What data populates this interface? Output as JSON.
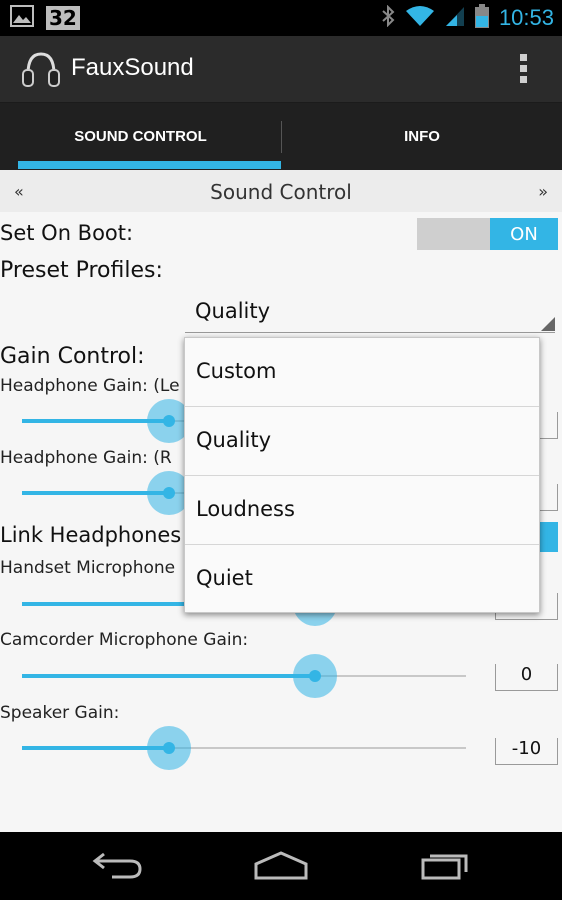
{
  "status_bar": {
    "notification_badge": "32",
    "time": "10:53",
    "icons": [
      "image-icon",
      "bluetooth-icon",
      "wifi-icon",
      "signal-icon",
      "battery-icon"
    ]
  },
  "action_bar": {
    "title": "FauxSound",
    "icons": [
      "headphones-icon",
      "overflow-menu-icon"
    ]
  },
  "tabs": [
    {
      "label": "SOUND CONTROL",
      "selected": true
    },
    {
      "label": "INFO",
      "selected": false
    }
  ],
  "pager": {
    "prev": "«",
    "title": "Sound Control",
    "next": "»"
  },
  "settings": {
    "set_on_boot_label": "Set On Boot:",
    "set_on_boot_toggle": "ON",
    "preset_profiles_label": "Preset Profiles:",
    "preset_selected": "Quality",
    "gain_control_label": "Gain Control:",
    "headphone_gain_left_label": "Headphone Gain: (Le",
    "headphone_gain_right_label": "Headphone Gain: (R",
    "link_headphones_label": "Link Headphones",
    "handset_mic_label": "Handset Microphone",
    "camcorder_mic_label": "Camcorder Microphone Gain:",
    "camcorder_mic_value": "0",
    "speaker_gain_label": "Speaker Gain:",
    "speaker_gain_value": "-10"
  },
  "sliders": {
    "headphone_left_fraction": 0.33,
    "headphone_right_fraction": 0.33,
    "handset_mic_fraction": 0.66,
    "camcorder_mic_fraction": 0.66,
    "speaker_fraction": 0.33
  },
  "preset_dropdown": {
    "options": [
      "Custom",
      "Quality",
      "Loudness",
      "Quiet"
    ]
  },
  "colors": {
    "accent": "#33b5e5",
    "action_bar": "#2b2b2b",
    "background": "#f6f6f6"
  },
  "nav_bar": {
    "icons": [
      "back-icon",
      "home-icon",
      "recents-icon"
    ]
  }
}
